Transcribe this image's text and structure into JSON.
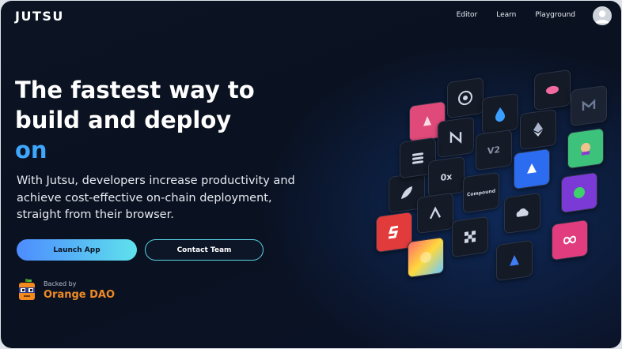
{
  "header": {
    "logo": "JUTSU",
    "nav": [
      "Editor",
      "Learn",
      "Playground"
    ]
  },
  "hero": {
    "headline_line1": "The fastest way to",
    "headline_line2": "build and deploy",
    "headline_accent": "on",
    "description": "With Jutsu, developers increase productivity and achieve cost-effective on-chain deployment, straight from their browser.",
    "launch_label": "Launch App",
    "contact_label": "Contact Team"
  },
  "backed": {
    "small": "Backed by",
    "name": "Orange DAO"
  },
  "tiles": {
    "v2": "V2",
    "ox": "0x",
    "compound": "Compound"
  },
  "colors": {
    "accent": "#3ea8ff",
    "orange": "#f08a24",
    "button_start": "#4d8cff",
    "button_end": "#5fe1ec"
  }
}
